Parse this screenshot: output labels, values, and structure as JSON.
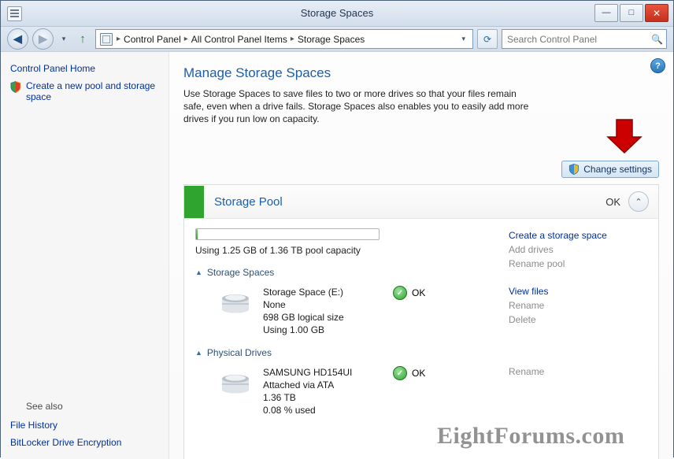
{
  "window": {
    "title": "Storage Spaces",
    "icon": "window-menu-icon",
    "buttons": {
      "minimize": "—",
      "maximize": "□",
      "close": "✕"
    }
  },
  "addressbar": {
    "back": "◀",
    "forward": "▶",
    "recent_dropdown": "▾",
    "up": "↑",
    "crumbs": [
      "Control Panel",
      "All Control Panel Items",
      "Storage Spaces"
    ],
    "separator": "▸",
    "crumb_dropdown": "▾",
    "refresh": "⟳",
    "search": {
      "placeholder": "Search Control Panel",
      "value": "",
      "icon": "search-icon"
    }
  },
  "sidebar": {
    "home_label": "Control Panel Home",
    "create_pool_label": "Create a new pool and storage space",
    "see_also_label": "See also",
    "links": [
      "File History",
      "BitLocker Drive Encryption"
    ]
  },
  "main": {
    "help_icon": "?",
    "title": "Manage Storage Spaces",
    "description": "Use Storage Spaces to save files to two or more drives so that your files remain safe, even when a drive fails. Storage Spaces also enables you to easily add more drives if you run low on capacity.",
    "change_settings_label": "Change settings",
    "pool": {
      "name": "Storage Pool",
      "status": "OK",
      "collapse_icon": "⌃",
      "capacity_text": "Using 1.25 GB of 1.36 TB pool capacity",
      "capacity_percent": 1,
      "actions": [
        {
          "label": "Create a storage space",
          "enabled": true
        },
        {
          "label": "Add drives",
          "enabled": false
        },
        {
          "label": "Rename pool",
          "enabled": false
        }
      ]
    },
    "spaces_section": {
      "heading": "Storage Spaces",
      "items": [
        {
          "name": "Storage Space (E:)",
          "resiliency": "None",
          "size": "698 GB logical size",
          "used": "Using 1.00 GB",
          "status": "OK",
          "actions": [
            {
              "label": "View files",
              "enabled": true
            },
            {
              "label": "Rename",
              "enabled": false
            },
            {
              "label": "Delete",
              "enabled": false
            }
          ]
        }
      ]
    },
    "drives_section": {
      "heading": "Physical Drives",
      "items": [
        {
          "name": "SAMSUNG HD154UI",
          "attached": "Attached via ATA",
          "size": "1.36 TB",
          "used": "0.08 % used",
          "status": "OK",
          "actions": [
            {
              "label": "Rename",
              "enabled": false
            }
          ]
        }
      ]
    }
  },
  "watermark": "EightForums.com",
  "colors": {
    "accent_link": "#00309c",
    "heading": "#1a5faa",
    "ok_green": "#2fa42f",
    "arrow_red": "#cc0000"
  }
}
